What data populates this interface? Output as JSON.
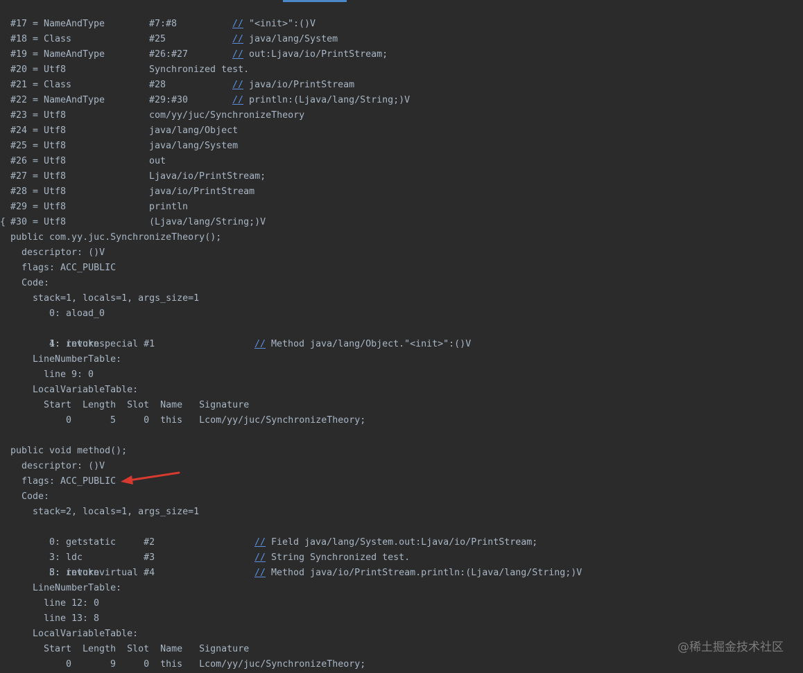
{
  "constant_pool": [
    {
      "index": "#17",
      "eq": "=",
      "type": "NameAndType",
      "ref": "#7:#8",
      "slashes": "//",
      "comment": "\"<init>\":()V"
    },
    {
      "index": "#18",
      "eq": "=",
      "type": "Class",
      "ref": "#25",
      "slashes": "//",
      "comment": "java/lang/System"
    },
    {
      "index": "#19",
      "eq": "=",
      "type": "NameAndType",
      "ref": "#26:#27",
      "slashes": "//",
      "comment": "out:Ljava/io/PrintStream;"
    },
    {
      "index": "#20",
      "eq": "=",
      "type": "Utf8",
      "ref": "Synchronized test.",
      "slashes": "",
      "comment": ""
    },
    {
      "index": "#21",
      "eq": "=",
      "type": "Class",
      "ref": "#28",
      "slashes": "//",
      "comment": "java/io/PrintStream"
    },
    {
      "index": "#22",
      "eq": "=",
      "type": "NameAndType",
      "ref": "#29:#30",
      "slashes": "//",
      "comment": "println:(Ljava/lang/String;)V"
    },
    {
      "index": "#23",
      "eq": "=",
      "type": "Utf8",
      "ref": "com/yy/juc/SynchronizeTheory",
      "slashes": "",
      "comment": ""
    },
    {
      "index": "#24",
      "eq": "=",
      "type": "Utf8",
      "ref": "java/lang/Object",
      "slashes": "",
      "comment": ""
    },
    {
      "index": "#25",
      "eq": "=",
      "type": "Utf8",
      "ref": "java/lang/System",
      "slashes": "",
      "comment": ""
    },
    {
      "index": "#26",
      "eq": "=",
      "type": "Utf8",
      "ref": "out",
      "slashes": "",
      "comment": ""
    },
    {
      "index": "#27",
      "eq": "=",
      "type": "Utf8",
      "ref": "Ljava/io/PrintStream;",
      "slashes": "",
      "comment": ""
    },
    {
      "index": "#28",
      "eq": "=",
      "type": "Utf8",
      "ref": "java/io/PrintStream",
      "slashes": "",
      "comment": ""
    },
    {
      "index": "#29",
      "eq": "=",
      "type": "Utf8",
      "ref": "println",
      "slashes": "",
      "comment": ""
    },
    {
      "index": "#30",
      "eq": "=",
      "type": "Utf8",
      "ref": "(Ljava/lang/String;)V",
      "slashes": "",
      "comment": ""
    }
  ],
  "body_lines": [
    {
      "text": "{",
      "slashes": "",
      "comment": ""
    },
    {
      "text": "public com.yy.juc.SynchronizeTheory();",
      "slashes": "",
      "comment": ""
    },
    {
      "text": "descriptor: ()V",
      "slashes": "",
      "comment": ""
    },
    {
      "text": "flags: ACC_PUBLIC",
      "slashes": "",
      "comment": ""
    },
    {
      "text": "Code:",
      "slashes": "",
      "comment": ""
    },
    {
      "text": "stack=1, locals=1, args_size=1",
      "slashes": "",
      "comment": ""
    },
    {
      "text": "0: aload_0",
      "slashes": "",
      "comment": ""
    },
    {
      "text": "1: invokespecial #1",
      "slashes": "//",
      "comment": "Method java/lang/Object.\"<init>\":()V"
    },
    {
      "text": "4: return",
      "slashes": "",
      "comment": ""
    },
    {
      "text": "LineNumberTable:",
      "slashes": "",
      "comment": ""
    },
    {
      "text": "line 9: 0",
      "slashes": "",
      "comment": ""
    },
    {
      "text": "LocalVariableTable:",
      "slashes": "",
      "comment": ""
    },
    {
      "text": "Start  Length  Slot  Name   Signature",
      "slashes": "",
      "comment": ""
    },
    {
      "text": "0       5     0  this   Lcom/yy/juc/SynchronizeTheory;",
      "slashes": "",
      "comment": ""
    },
    {
      "text": "",
      "slashes": "",
      "comment": ""
    },
    {
      "text": "public void method();",
      "slashes": "",
      "comment": ""
    },
    {
      "text": "descriptor: ()V",
      "slashes": "",
      "comment": ""
    },
    {
      "text": "flags: ACC_PUBLIC",
      "slashes": "",
      "comment": ""
    },
    {
      "text": "Code:",
      "slashes": "",
      "comment": ""
    },
    {
      "text": "stack=2, locals=1, args_size=1",
      "slashes": "",
      "comment": ""
    },
    {
      "text": "0: getstatic     #2",
      "slashes": "//",
      "comment": "Field java/lang/System.out:Ljava/io/PrintStream;"
    },
    {
      "text": "3: ldc           #3",
      "slashes": "//",
      "comment": "String Synchronized test."
    },
    {
      "text": "5: invokevirtual #4",
      "slashes": "//",
      "comment": "Method java/io/PrintStream.println:(Ljava/lang/String;)V"
    },
    {
      "text": "8: return",
      "slashes": "",
      "comment": ""
    },
    {
      "text": "LineNumberTable:",
      "slashes": "",
      "comment": ""
    },
    {
      "text": "line 12: 0",
      "slashes": "",
      "comment": ""
    },
    {
      "text": "line 13: 8",
      "slashes": "",
      "comment": ""
    },
    {
      "text": "LocalVariableTable:",
      "slashes": "",
      "comment": ""
    },
    {
      "text": "Start  Length  Slot  Name   Signature",
      "slashes": "",
      "comment": ""
    },
    {
      "text": "0       9     0  this   Lcom/yy/juc/SynchronizeTheory;",
      "slashes": "",
      "comment": ""
    }
  ],
  "annotation": {
    "arrow_color": "#d93a2f",
    "points_to": "flags: ACC_PUBLIC"
  },
  "watermark": "@稀土掘金技术社区",
  "colors": {
    "background": "#2b2b2b",
    "text": "#a9b7c6",
    "comment_slashes": "#5b8fe0"
  }
}
